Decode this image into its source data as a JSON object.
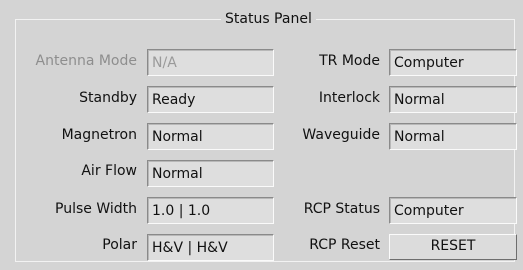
{
  "panel": {
    "title": "Status Panel"
  },
  "left": [
    {
      "label": "Antenna Mode",
      "value": "N/A"
    },
    {
      "label": "Standby",
      "value": "Ready"
    },
    {
      "label": "Magnetron",
      "value": "Normal"
    },
    {
      "label": "Air Flow",
      "value": "Normal"
    },
    {
      "label": "Pulse Width",
      "value": "1.0 | 1.0"
    },
    {
      "label": "Polar",
      "value": "H&V | H&V"
    }
  ],
  "right": [
    {
      "label": "TR Mode",
      "value": "Computer"
    },
    {
      "label": "Interlock",
      "value": "Normal"
    },
    {
      "label": "Waveguide",
      "value": "Normal"
    },
    {
      "label": "RCP Status",
      "value": "Computer"
    },
    {
      "label": "RCP Reset",
      "button": "RESET"
    }
  ]
}
